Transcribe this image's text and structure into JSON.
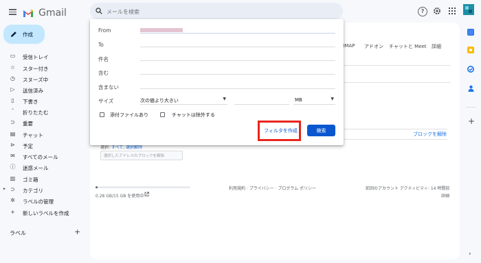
{
  "app": {
    "brand": "Gmail"
  },
  "search": {
    "placeholder": "メールを検索"
  },
  "compose": {
    "label": "作成"
  },
  "sidebar": {
    "items": [
      {
        "icon": "inbox-icon",
        "glyph": "▭",
        "label": "受信トレイ"
      },
      {
        "icon": "star-icon",
        "glyph": "☆",
        "label": "スター付き"
      },
      {
        "icon": "clock-icon",
        "glyph": "◷",
        "label": "スヌーズ中"
      },
      {
        "icon": "send-icon",
        "glyph": "▷",
        "label": "送信済み"
      },
      {
        "icon": "draft-icon",
        "glyph": "▯",
        "label": "下書き"
      },
      {
        "icon": "chevron-up-icon",
        "glyph": "ˆ",
        "label": "折りたたむ"
      },
      {
        "icon": "important-icon",
        "glyph": "⊃",
        "label": "重要"
      },
      {
        "icon": "chat-icon",
        "glyph": "▤",
        "label": "チャット"
      },
      {
        "icon": "scheduled-icon",
        "glyph": "⊳",
        "label": "予定"
      },
      {
        "icon": "all-mail-icon",
        "glyph": "✉",
        "label": "すべてのメール"
      },
      {
        "icon": "spam-icon",
        "glyph": "ⓘ",
        "label": "迷惑メール"
      },
      {
        "icon": "trash-icon",
        "glyph": "▥",
        "label": "ゴミ箱"
      },
      {
        "icon": "category-icon",
        "glyph": "⊃",
        "label": "カテゴリ"
      },
      {
        "icon": "gear-icon",
        "glyph": "✲",
        "label": "ラベルの管理"
      },
      {
        "icon": "plus-icon",
        "glyph": "+",
        "label": "新しいラベルを作成"
      }
    ],
    "labels_header": "ラベル",
    "labels_add": "+"
  },
  "settings_tabs": {
    "imap": "/IMAP",
    "addons": "アドオン",
    "chat_meet": "チャットと Meet",
    "advanced": "詳細"
  },
  "filter": {
    "from_label": "From",
    "to_label": "To",
    "subject_label": "件名",
    "has_words_label": "含む",
    "not_has_label": "含まない",
    "size_label": "サイズ",
    "size_op": "次の値より大きい",
    "size_unit": "MB",
    "has_attachment": "添付ファイルあり",
    "exclude_chats": "チャットは除外する",
    "create_filter": "フィルタを作成",
    "search_button": "検索"
  },
  "main": {
    "block_link": "ブロックを解除",
    "select_text": "選択:",
    "select_all": "すべて",
    "select_none": "選択解除",
    "unblock_selected": "選択したアドレスのブロックを解除",
    "storage": "0.28 GB/15 GB を使用中",
    "storage_fraction": 0.02,
    "footer_links": "利用規約 · プライバシー · プログラム ポリシー",
    "last_activity": "前回のアカウント アクティビティ: 14 時間前",
    "details": "詳細"
  },
  "colors": {
    "highlight": "#e8251b",
    "primary": "#0b57d0",
    "compose": "#c2e7ff"
  }
}
